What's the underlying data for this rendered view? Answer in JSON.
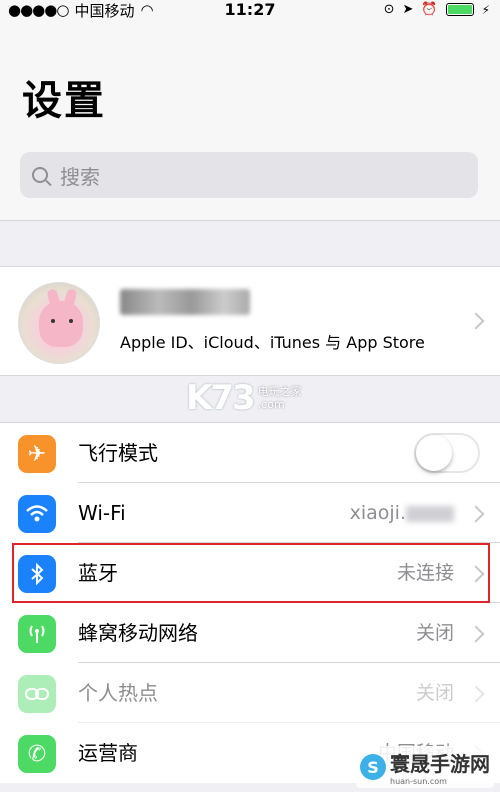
{
  "status_bar": {
    "carrier": "中国移动",
    "time": "11:27"
  },
  "header": {
    "title": "设置",
    "search_placeholder": "搜索"
  },
  "profile": {
    "name": "",
    "subtitle": "Apple ID、iCloud、iTunes 与 App Store"
  },
  "settings": [
    {
      "label": "飞行模式",
      "value": "",
      "icon": "airplane-icon",
      "color": "#f7932a",
      "toggle": false
    },
    {
      "label": "Wi-Fi",
      "value": "xiaoji.",
      "icon": "wifi-icon",
      "color": "#1a82fb"
    },
    {
      "label": "蓝牙",
      "value": "未连接",
      "icon": "bluetooth-icon",
      "color": "#1a82fb"
    },
    {
      "label": "蜂窝移动网络",
      "value": "关闭",
      "icon": "cellular-icon",
      "color": "#4cd964"
    },
    {
      "label": "个人热点",
      "value": "关闭",
      "icon": "hotspot-icon",
      "color": "#4cd964"
    },
    {
      "label": "运营商",
      "value": "中国移动",
      "icon": "phone-icon",
      "color": "#4cd964"
    }
  ],
  "watermark": {
    "k73_logo": "K73",
    "k73_text": "电玩之家",
    "k73_sub": ".com",
    "site_name": "寰晟手游网",
    "site_url": "huan-sun.com",
    "site_logo": "S"
  },
  "colors": {
    "highlight": "#e0242a",
    "toggle_off": "#e5e5ea"
  }
}
